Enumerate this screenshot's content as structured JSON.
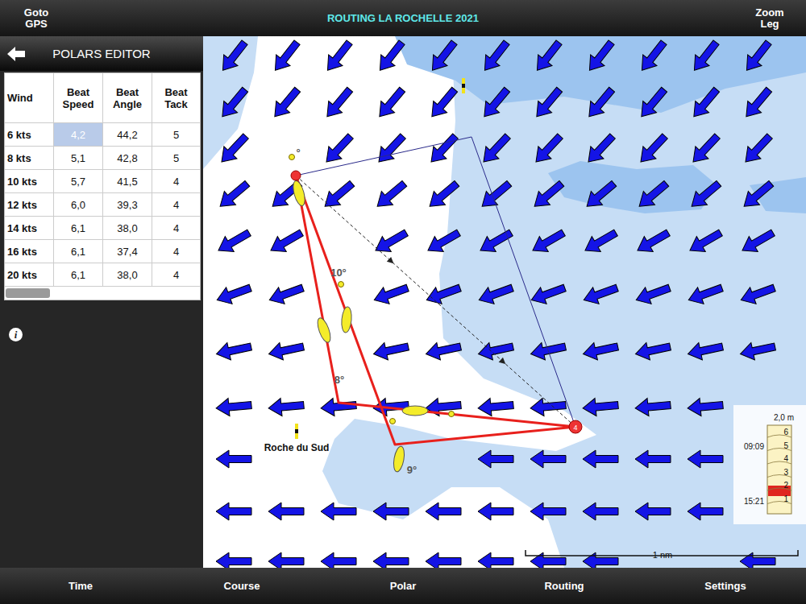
{
  "top_bar": {
    "left_button": [
      "Goto",
      "GPS"
    ],
    "title": "ROUTING LA ROCHELLE 2021",
    "right_button": [
      "Zoom",
      "Leg"
    ]
  },
  "panel": {
    "title": "POLARS EDITOR",
    "info": "i"
  },
  "table": {
    "columns": [
      {
        "lines": [
          "Wind"
        ]
      },
      {
        "lines": [
          "Beat",
          "Speed"
        ]
      },
      {
        "lines": [
          "Beat",
          "Angle"
        ]
      },
      {
        "lines": [
          "Beat",
          "Tack"
        ]
      }
    ],
    "rows": [
      {
        "cells": [
          {
            "text": "6 kts",
            "selected": false
          },
          {
            "text": "4,2",
            "selected": true
          },
          {
            "text": "44,2",
            "selected": false
          },
          {
            "text": "5",
            "selected": false
          }
        ]
      },
      {
        "cells": [
          {
            "text": "8 kts",
            "selected": false
          },
          {
            "text": "5,1",
            "selected": false
          },
          {
            "text": "42,8",
            "selected": false
          },
          {
            "text": "5",
            "selected": false
          }
        ]
      },
      {
        "cells": [
          {
            "text": "10 kts",
            "selected": false
          },
          {
            "text": "5,7",
            "selected": false
          },
          {
            "text": "41,5",
            "selected": false
          },
          {
            "text": "4",
            "selected": false
          }
        ]
      },
      {
        "cells": [
          {
            "text": "12 kts",
            "selected": false
          },
          {
            "text": "6,0",
            "selected": false
          },
          {
            "text": "39,3",
            "selected": false
          },
          {
            "text": "4",
            "selected": false
          }
        ]
      },
      {
        "cells": [
          {
            "text": "14 kts",
            "selected": false
          },
          {
            "text": "6,1",
            "selected": false
          },
          {
            "text": "38,0",
            "selected": false
          },
          {
            "text": "4",
            "selected": false
          }
        ]
      },
      {
        "cells": [
          {
            "text": "16 kts",
            "selected": false
          },
          {
            "text": "6,1",
            "selected": false
          },
          {
            "text": "37,4",
            "selected": false
          },
          {
            "text": "4",
            "selected": false
          }
        ]
      },
      {
        "cells": [
          {
            "text": "20 kts",
            "selected": false
          },
          {
            "text": "6,1",
            "selected": false
          },
          {
            "text": "38,0",
            "selected": false
          },
          {
            "text": "4",
            "selected": false
          }
        ]
      }
    ]
  },
  "map": {
    "wind_row_angles": [
      128,
      130,
      133,
      140,
      150,
      160,
      168,
      175,
      180,
      180,
      180
    ],
    "leg_labels": [
      {
        "text": "°"
      },
      {
        "text": "10°"
      },
      {
        "text": "8°"
      },
      {
        "text": "9°"
      }
    ],
    "waypoint_label": "4",
    "buoy_label": "Roche du Sud",
    "scale": "1 nm",
    "tide": {
      "title": "2,0 m",
      "ticks": [
        "6",
        "5",
        "4",
        "3",
        "2",
        "1"
      ],
      "times": [
        "09:09",
        "15:21"
      ],
      "level": 0.2
    }
  },
  "bottom_bar": [
    "Time",
    "Course",
    "Polar",
    "Routing",
    "Settings"
  ]
}
